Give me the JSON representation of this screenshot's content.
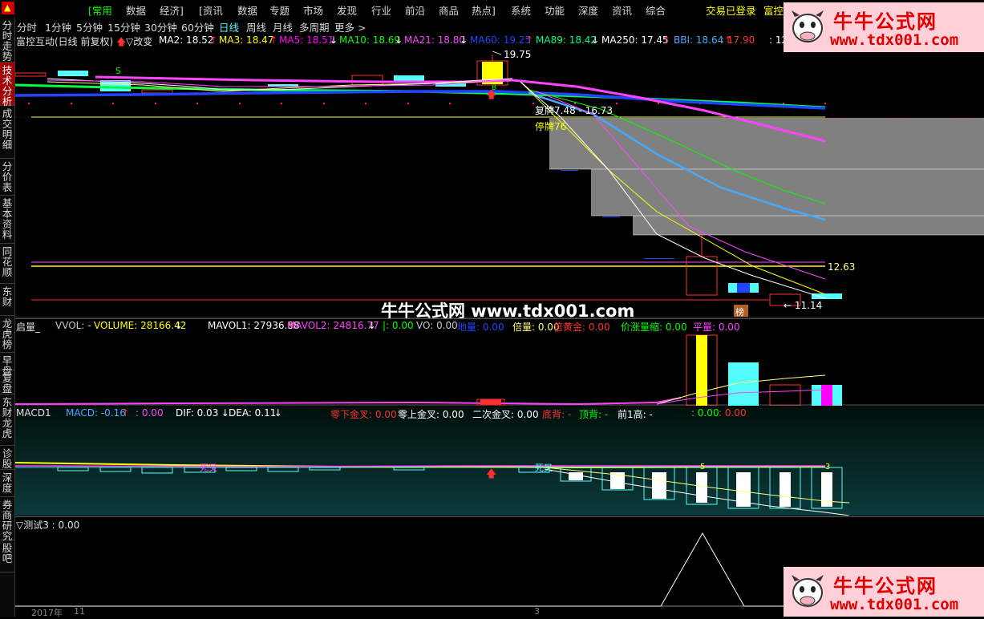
{
  "menu": {
    "items": [
      "[常用",
      "数据",
      "经济]",
      "[资讯",
      "数据",
      "专题",
      "市场",
      "发现",
      "行业",
      "前沿",
      "商品",
      "热点]",
      "系统",
      "功能",
      "深度",
      "资讯",
      "综合"
    ],
    "status": "交易已登录",
    "stock_cut": "富控"
  },
  "periods": {
    "items": [
      "分时",
      "1分钟",
      "5分钟",
      "15分钟",
      "30分钟",
      "60分钟",
      "日线",
      "周线",
      "月线",
      "多周期",
      "更多 >"
    ],
    "active": "日线"
  },
  "sidebar": {
    "items": [
      "分时走势",
      "技术分析",
      "成交明细",
      "分价表",
      "基本资料",
      "同花顺",
      "东财",
      "龙虎榜",
      "早盘",
      "复盘",
      "东财龙虎",
      "诊股",
      "深度",
      "券商研究",
      "股吧"
    ],
    "active": "技术分析"
  },
  "main": {
    "title": "富控互动(日线 前复权)",
    "change_label": "▽改变",
    "ma": [
      {
        "label": "MA2: 18.52",
        "arrow": "↑",
        "color": "#ffffff"
      },
      {
        "label": "MA3: 18.47",
        "arrow": "↑",
        "color": "#ffff00"
      },
      {
        "label": "MA5: 18.51",
        "arrow": "↓",
        "color": "#ff00ff"
      },
      {
        "label": "MA10: 18.69",
        "arrow": "↓",
        "color": "#00ff00"
      },
      {
        "label": "MA21: 18.80",
        "arrow": "↓",
        "color": "#ff44ff"
      },
      {
        "label": "MA60: 19.25",
        "arrow": "↑",
        "color": "#2244ff"
      },
      {
        "label": "MA89: 18.42",
        "arrow": "↓",
        "color": "#00ff80"
      },
      {
        "label": "MA250: 17.45",
        "arrow": "↑",
        "color": "#ffffff"
      },
      {
        "label": "BBI: 18.64",
        "arrow": "↑",
        "color": "#44aaff"
      },
      {
        "label": ": 17.90",
        "arrow": "",
        "color": "#ff3030"
      },
      {
        "label": ": 12",
        "arrow": "",
        "color": "#ffffff"
      }
    ],
    "annotations": {
      "high": "19.75",
      "range": "复牌7.48 - 16.73",
      "suspend": "停牌76",
      "right_price": "12.63",
      "low": "← 11.14",
      "s_mark": "S",
      "b_mark": "B",
      "bang": "榜"
    },
    "colors": {
      "up": "#ff3030",
      "down": "#54fcfc",
      "ma60": "#2244ff",
      "grey": "#808080"
    }
  },
  "volume": {
    "title": "启量_",
    "fields": [
      {
        "label": "VVOL: -",
        "color": "#c8c8c8"
      },
      {
        "label": "VOLUME: 28166.42",
        "arrow": "↓",
        "color": "#ffff00"
      },
      {
        "label": "MAVOL1: 27936.88",
        "arrow": "↑",
        "color": "#ffffff"
      },
      {
        "label": "MAVOL2: 24816.77",
        "arrow": "↓",
        "color": "#ff44ff"
      },
      {
        "label": "|: 0.00",
        "color": "#00ff00"
      },
      {
        "label": "VO: 0.00",
        "color": "#c8c8c8"
      },
      {
        "label": "地量: 0.00",
        "color": "#2244ff"
      },
      {
        "label": "倍量: 0.00",
        "color": "#ffff80"
      },
      {
        "label": "倍黄金: 0.00",
        "color": "#ff3030"
      },
      {
        "label": "价涨量缩: 0.00",
        "color": "#00ff00"
      },
      {
        "label": "平量: 0.00",
        "color": "#ff44ff"
      }
    ]
  },
  "macd": {
    "title": "MACD1",
    "fields": [
      {
        "label": "MACD: -0.16",
        "arrow": "↑",
        "color": "#44aaff"
      },
      {
        "label": ": 0.00",
        "color": "#ff44ff"
      },
      {
        "label": "DIF: 0.03",
        "arrow": "↓",
        "color": "#ffffff"
      },
      {
        "label": "DEA: 0.11",
        "arrow": "↓",
        "color": "#ffffff"
      },
      {
        "label": "零下金叉: 0.00",
        "color": "#ff3030"
      },
      {
        "label": "零上金叉: 0.00",
        "color": "#ffffff"
      },
      {
        "label": "二次金叉: 0.00",
        "color": "#ffffff"
      },
      {
        "label": "底背: -",
        "color": "#ff3030"
      },
      {
        "label": "顶背: -",
        "color": "#00ff00"
      },
      {
        "label": "前1高: -",
        "color": "#ffffff"
      },
      {
        "label": ": 0.00",
        "color": "#00ff00"
      },
      {
        "label": ": 0.00",
        "color": "#ff3030"
      }
    ],
    "marks": {
      "cross1": "死叉",
      "cross2": "死叉",
      "num1": "5",
      "num2": "3"
    }
  },
  "test": {
    "title": "▽测试3 : 0.00"
  },
  "timeline": {
    "year": "2017年",
    "m1": "11",
    "m2": "3"
  },
  "watermark": {
    "cn": "牛牛公式网",
    "url": "www.tdx001.com",
    "center": "牛牛公式网 www.tdx001.com"
  }
}
